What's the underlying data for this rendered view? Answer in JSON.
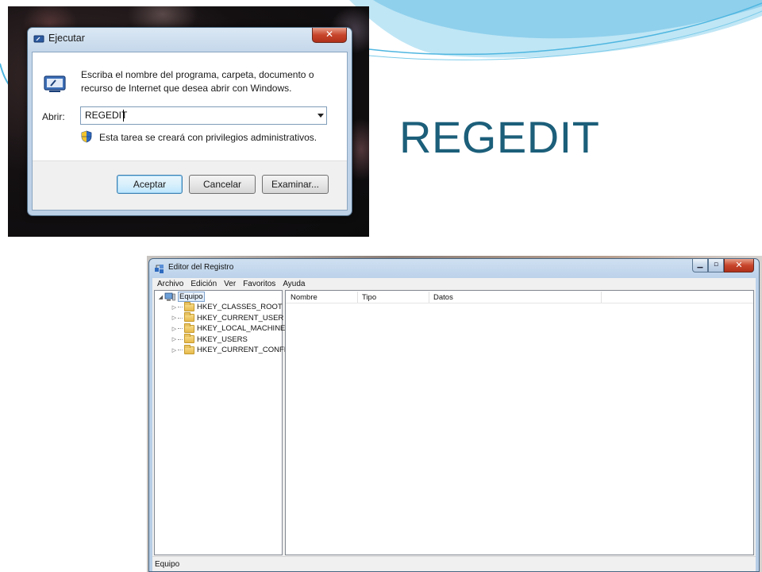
{
  "slide": {
    "title": "REGEDIT",
    "title_color": "#1c5f7a",
    "accent_color": "#4fb6e0"
  },
  "run_dialog": {
    "title": "Ejecutar",
    "close_icon": "close-icon",
    "app_icon": "run-icon",
    "description": "Escriba el nombre del programa, carpeta, documento o recurso de Internet que desea abrir con Windows.",
    "open_label": "Abrir:",
    "open_value": "REGEDIT",
    "shield_icon": "uac-shield-icon",
    "admin_note": "Esta tarea se creará con privilegios administrativos.",
    "buttons": {
      "ok": "Aceptar",
      "cancel": "Cancelar",
      "browse": "Examinar..."
    }
  },
  "registry_editor": {
    "title": "Editor del Registro",
    "menu": [
      "Archivo",
      "Edición",
      "Ver",
      "Favoritos",
      "Ayuda"
    ],
    "caption_buttons": {
      "minimize": "minimize-icon",
      "maximize": "maximize-icon",
      "close": "close-icon"
    },
    "tree": {
      "root": "Equipo",
      "keys": [
        "HKEY_CLASSES_ROOT",
        "HKEY_CURRENT_USER",
        "HKEY_LOCAL_MACHINE",
        "HKEY_USERS",
        "HKEY_CURRENT_CONFIG"
      ]
    },
    "columns": [
      "Nombre",
      "Tipo",
      "Datos"
    ],
    "status": "Equipo"
  }
}
